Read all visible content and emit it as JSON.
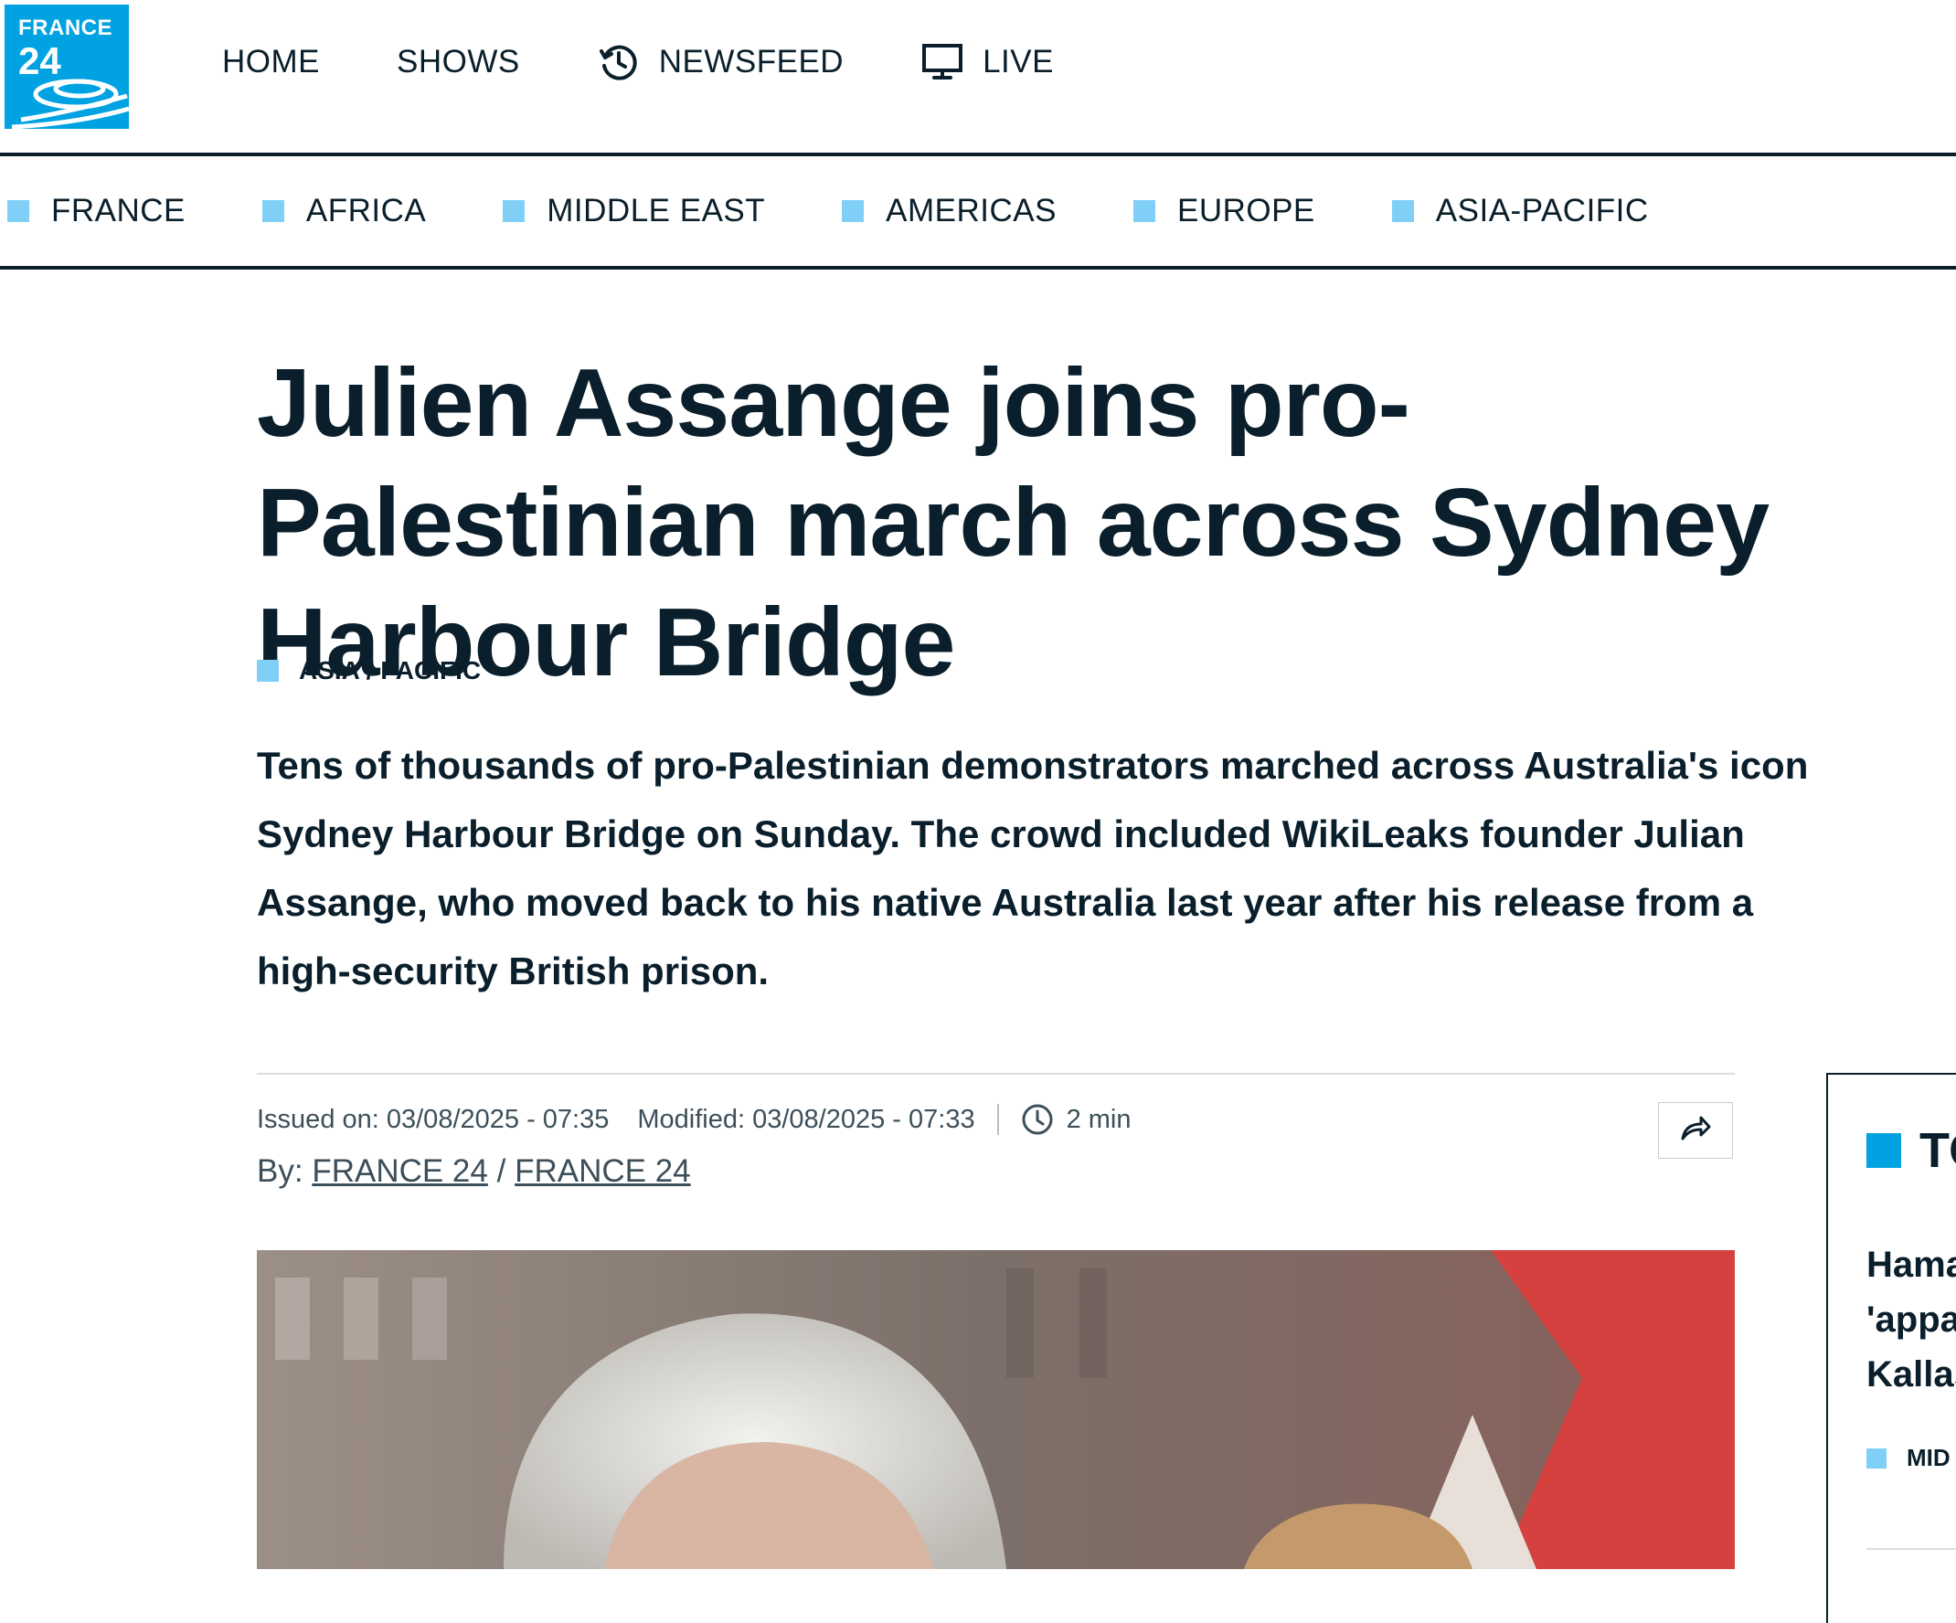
{
  "brand": {
    "logo_word": "FRANCE",
    "logo_number": "24",
    "color": "#00a2e1"
  },
  "main_nav": [
    {
      "label": "HOME",
      "icon": null
    },
    {
      "label": "SHOWS",
      "icon": null
    },
    {
      "label": "NEWSFEED",
      "icon": "history-clock-icon"
    },
    {
      "label": "LIVE",
      "icon": "tv-monitor-icon"
    }
  ],
  "region_nav": [
    "FRANCE",
    "AFRICA",
    "MIDDLE EAST",
    "AMERICAS",
    "EUROPE",
    "ASIA-PACIFIC"
  ],
  "article": {
    "headline_lines": [
      "Julien Assange joins pro-",
      "Palestinian march across Sydney",
      "Harbour Bridge"
    ],
    "category": "ASIA / PACIFIC",
    "lede_lines": [
      "Tens of thousands of pro-Palestinian demonstrators marched across Australia's icon",
      "Sydney Harbour Bridge on Sunday. The crowd included WikiLeaks founder Julian",
      "Assange, who moved back to his native Australia last year after his release from a",
      "high-security British prison."
    ],
    "issued": "Issued on: 03/08/2025 - 07:35",
    "modified": "Modified: 03/08/2025 - 07:33",
    "read_time": "2 min",
    "by_prefix": "By:",
    "authors": [
      "FRANCE 24",
      "FRANCE 24"
    ],
    "author_separator": "/"
  },
  "sidebar": {
    "heading": "TO",
    "story_title_lines": [
      "Hama",
      "'appa",
      "Kallas"
    ],
    "story_tag": "MID"
  },
  "colors": {
    "text": "#0a1f2b",
    "accent": "#00a2e1",
    "category_square": "#7fcff7",
    "meta_text": "#3d4f5a"
  }
}
